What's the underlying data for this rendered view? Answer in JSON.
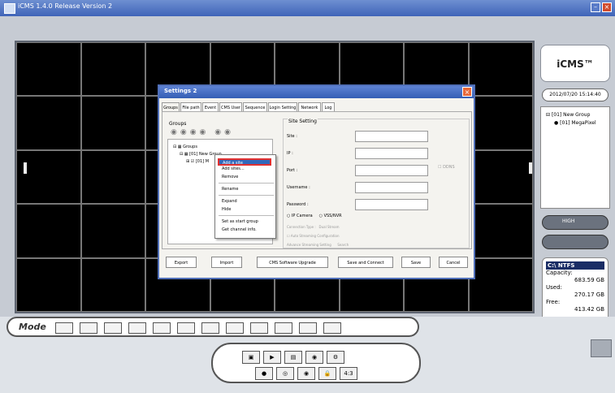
{
  "app": {
    "title": "iCMS 1.4.0 Release Version 2"
  },
  "logo": {
    "text": "iCMS™"
  },
  "datetime": "2012/07/20 15:14:40",
  "tree": {
    "group": "[01] New Group",
    "camera": "[01] MegaPixel"
  },
  "controls": {
    "quality": "HIGH"
  },
  "disk": {
    "drive": "C:\\ NTFS",
    "capacity_label": "Capacity:",
    "capacity": "683.59 GB",
    "used_label": "Used:",
    "used": "270.17 GB",
    "free_label": "Free:",
    "free": "413.42 GB"
  },
  "mode": {
    "label": "Mode"
  },
  "ctrl": {
    "ratio": "4:3"
  },
  "dialog": {
    "title": "Settings 2",
    "tabs": [
      "Groups",
      "File path",
      "Event",
      "CMS User",
      "Sequence",
      "Login Setting",
      "Network",
      "Log"
    ],
    "groups_label": "Groups",
    "tree": {
      "root": "Groups",
      "group": "[01] New Group",
      "site": "[01] M"
    },
    "site_setting": {
      "title": "Site Setting",
      "site_label": "Site :",
      "ip_label": "IP :",
      "port_label": "Port :",
      "username_label": "Username :",
      "password_label": "Password :",
      "ddns_label": "DDNS",
      "radio_ip_camera": "IP Camera",
      "radio_vss": "VSS/NVR",
      "connection_type_label": "Connection Type :",
      "connection_type_value": "Dual Stream",
      "auto_streaming": "Auto Streaming Configuration",
      "advance_streaming": "Advance Streaming Setting",
      "search": "Search"
    },
    "buttons": [
      "Export",
      "Import",
      "CMS Software Upgrade",
      "Save and Connect",
      "Save",
      "Cancel"
    ]
  },
  "context_menu": {
    "items": [
      "Add a site",
      "Add sites...",
      "Remove",
      "Rename",
      "Expand",
      "Hide",
      "Set as start group",
      "Get channel info."
    ]
  }
}
